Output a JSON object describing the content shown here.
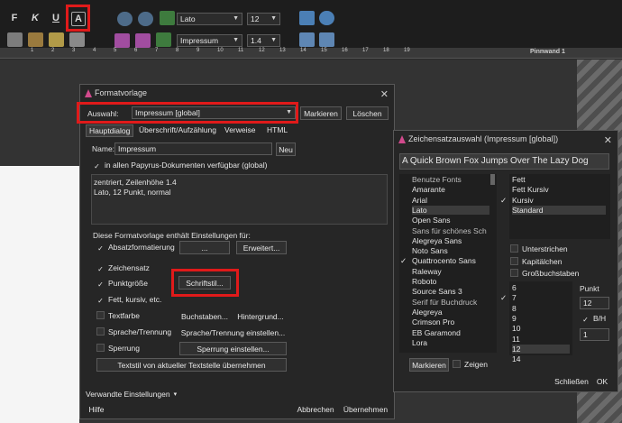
{
  "toolbar": {
    "format_buttons": [
      "F",
      "K",
      "U",
      "A"
    ],
    "font_name": "Lato",
    "font_size": "12",
    "style_name": "Impressum",
    "line_height": "1.4",
    "icons": [
      "style-chooser-icon",
      "undo-icon",
      "redo-icon",
      "new-doc-icon",
      "save-icon",
      "save-as-icon",
      "print-icon",
      "masks-icon",
      "speech-bubble-icon",
      "paragraph-icon",
      "film-icon",
      "key-icon",
      "list-icon",
      "location-pin-icon",
      "search-doc-icon"
    ]
  },
  "ruler": {
    "numbers": [
      "1",
      "2",
      "3",
      "4",
      "5",
      "6",
      "7",
      "8",
      "9",
      "10",
      "11",
      "12",
      "13",
      "14",
      "15",
      "16",
      "17",
      "18",
      "19"
    ],
    "panel_label": "Pinnwand 1"
  },
  "formatvorlage": {
    "title": "Formatvorlage",
    "auswahl_label": "Auswahl:",
    "auswahl_value": "Impressum [global]",
    "markieren": "Markieren",
    "loeschen": "Löschen",
    "tabs": [
      "Hauptdialog",
      "Überschrift/Aufzählung",
      "Verweise",
      "HTML"
    ],
    "name_label": "Name:",
    "name_value": "Impressum",
    "neu": "Neu",
    "global_check": "in allen Papyrus-Dokumenten verfügbar (global)",
    "description": [
      "zentriert, Zeilenhöhe 1.4",
      "Lato, 12 Punkt, normal"
    ],
    "contains_label": "Diese Formatvorlage enthält Einstellungen für:",
    "absatz": "Absatzformatierung",
    "ellipsis": "...",
    "erweitert": "Erweitert...",
    "zeichensatz": "Zeichensatz",
    "punktgroesse": "Punktgröße",
    "schriftstil": "Schriftstil...",
    "fett_kursiv": "Fett, kursiv, etc.",
    "textfarbe": "Textfarbe",
    "buchstaben": "Buchstaben...",
    "hintergrund": "Hintergrund...",
    "sprache": "Sprache/Trennung",
    "sprache_btn": "Sprache/Trennung einstellen...",
    "sperrung": "Sperrung",
    "sperrung_btn": "Sperrung einstellen...",
    "textstil": "Textstil von aktueller Textstelle übernehmen",
    "verwandte": "Verwandte Einstellungen",
    "hilfe": "Hilfe",
    "abbrechen": "Abbrechen",
    "uebernehmen": "Übernehmen"
  },
  "zeichensatz": {
    "title": "Zeichensatzauswahl (Impressum [global])",
    "preview": "A Quick Brown Fox Jumps Over The Lazy Dog",
    "fonts": [
      {
        "t": "Benutze Fonts",
        "h": true
      },
      {
        "t": "Amarante"
      },
      {
        "t": "Arial"
      },
      {
        "t": "Lato",
        "sel": true
      },
      {
        "t": "Open Sans"
      },
      {
        "t": "Sans für schönes Sch",
        "h": true
      },
      {
        "t": "Alegreya Sans"
      },
      {
        "t": "Noto Sans"
      },
      {
        "t": "Quattrocento Sans",
        "chk": true
      },
      {
        "t": "Raleway"
      },
      {
        "t": "Roboto"
      },
      {
        "t": "Source Sans 3"
      },
      {
        "t": "Serif für Buchdruck",
        "h": true
      },
      {
        "t": "Alegreya"
      },
      {
        "t": "Crimson Pro"
      },
      {
        "t": "EB Garamond"
      },
      {
        "t": "Lora"
      }
    ],
    "styles": [
      {
        "t": "Fett"
      },
      {
        "t": "Fett Kursiv"
      },
      {
        "t": "Kursiv",
        "chk": true
      },
      {
        "t": "Standard",
        "sel": true
      }
    ],
    "unterstrichen": "Unterstrichen",
    "kapitaelchen": "Kapitälchen",
    "grossbuchstaben": "Großbuchstaben",
    "sizes": [
      {
        "t": "6"
      },
      {
        "t": "7",
        "chk": true
      },
      {
        "t": "8"
      },
      {
        "t": "9"
      },
      {
        "t": "10"
      },
      {
        "t": "11"
      },
      {
        "t": "12",
        "sel": true
      },
      {
        "t": "14"
      }
    ],
    "punkt_label": "Punkt",
    "punkt_value": "12",
    "bh_label": "B/H",
    "bh_value": "1",
    "markieren": "Markieren",
    "zeigen": "Zeigen",
    "schliessen": "Schließen",
    "ok": "OK"
  },
  "colors": {
    "accent_red": "#e01a1a",
    "dialog_bg": "#262626",
    "style_icon": "#d24a8d"
  }
}
